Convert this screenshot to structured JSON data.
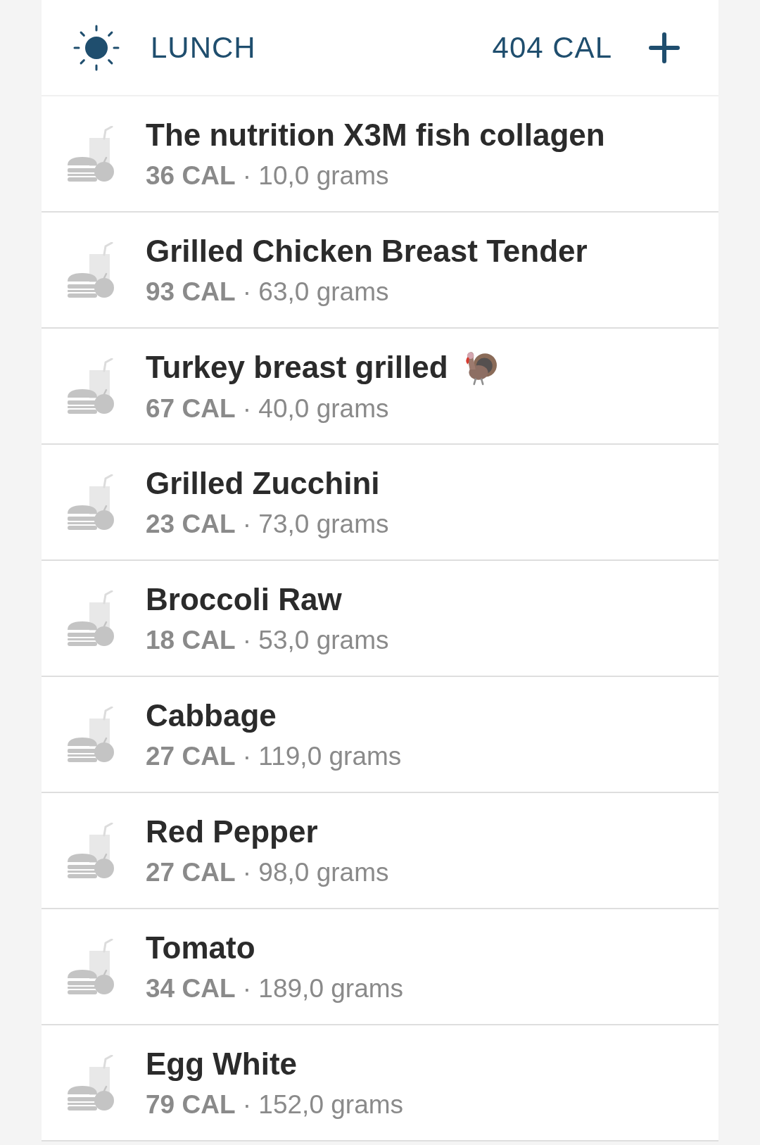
{
  "meal": {
    "title": "LUNCH",
    "calories": "404 CAL"
  },
  "items": [
    {
      "name": "The nutrition X3M fish collagen",
      "emoji": false,
      "details": "**36 CAL** · 10,0 grams"
    },
    {
      "name": "Grilled Chicken Breast Tender",
      "emoji": false,
      "details": "**93 CAL** · 63,0 grams"
    },
    {
      "name": "Turkey breast grilled",
      "emoji": true,
      "details": "**67 CAL** · 40,0 grams"
    },
    {
      "name": "Grilled Zucchini",
      "emoji": false,
      "details": "**23 CAL** · 73,0 grams"
    },
    {
      "name": "Broccoli Raw",
      "emoji": false,
      "details": "**18 CAL** · 53,0 grams"
    },
    {
      "name": "Cabbage",
      "emoji": false,
      "details": "**27 CAL** · 119,0 grams"
    },
    {
      "name": "Red Pepper",
      "emoji": false,
      "details": "**27 CAL** · 98,0 grams"
    },
    {
      "name": "Tomato",
      "emoji": false,
      "details": "**34 CAL** · 189,0 grams"
    },
    {
      "name": "Egg White",
      "emoji": false,
      "details": "**79 CAL** · 152,0 grams"
    }
  ]
}
